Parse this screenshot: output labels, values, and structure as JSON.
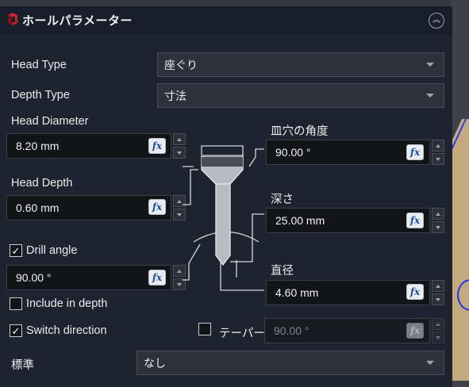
{
  "panel": {
    "title": "ホールパラメーター",
    "collapse_glyph": "︽"
  },
  "head_type": {
    "label": "Head Type",
    "value": "座ぐり"
  },
  "depth_type": {
    "label": "Depth Type",
    "value": "寸法"
  },
  "head_diameter": {
    "label": "Head Diameter",
    "value": "8.20 mm"
  },
  "head_depth": {
    "label": "Head Depth",
    "value": "0.60 mm"
  },
  "drill_angle": {
    "label": "Drill angle",
    "checked": true,
    "value": "90.00 °"
  },
  "include_in_depth": {
    "label": "Include in depth",
    "checked": false
  },
  "switch_direction": {
    "label": "Switch direction",
    "checked": true
  },
  "countersink_angle": {
    "label": "皿穴の角度",
    "value": "90.00 °"
  },
  "depth": {
    "label": "深さ",
    "value": "25.00 mm"
  },
  "diameter": {
    "label": "直径",
    "value": "4.60 mm"
  },
  "taper": {
    "label": "テーパー",
    "checked": false,
    "value": "90.00 °"
  },
  "standard": {
    "label": "標準",
    "value": "なし"
  },
  "fx_label": "fx",
  "check_glyph": "✓",
  "colors": {
    "panel_bg": "#1f2330",
    "field_bg": "#121418",
    "accent_blue": "#2233ee",
    "canvas_part": "#c5a97e"
  }
}
